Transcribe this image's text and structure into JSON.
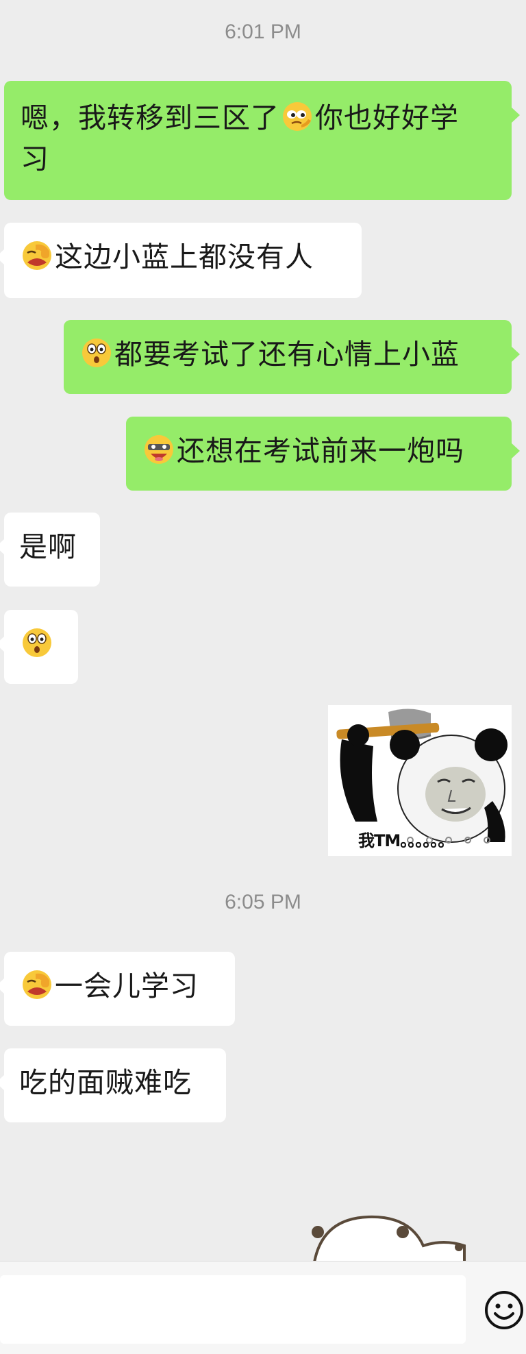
{
  "timestamps": [
    "6:01 PM",
    "6:05 PM"
  ],
  "messages": [
    {
      "side": "me",
      "parts": [
        {
          "text": "嗯，我转移到三区了"
        },
        {
          "icon": "smirk-emoji"
        },
        {
          "text": "你也好好学习"
        }
      ]
    },
    {
      "side": "them",
      "parts": [
        {
          "icon": "facepalm-emoji"
        },
        {
          "text": "这边小蓝上都没有人"
        }
      ]
    },
    {
      "side": "me",
      "parts": [
        {
          "icon": "shocked-emoji"
        },
        {
          "text": "都要考试了还有心情上小蓝"
        }
      ]
    },
    {
      "side": "me",
      "parts": [
        {
          "icon": "grin-emoji"
        },
        {
          "text": "还想在考试前来一炮吗"
        }
      ]
    },
    {
      "side": "them",
      "parts": [
        {
          "text": "是啊"
        }
      ]
    },
    {
      "side": "them",
      "parts": [
        {
          "icon": "shocked-emoji"
        }
      ]
    },
    {
      "side": "me",
      "parts": [
        {
          "sticker": "panda-axe-sticker",
          "caption": "我TM。。。。。。"
        }
      ]
    },
    {
      "side": "them",
      "parts": [
        {
          "icon": "facepalm-emoji"
        },
        {
          "text": "一会儿学习"
        }
      ]
    },
    {
      "side": "them",
      "parts": [
        {
          "text": "吃的面贼难吃"
        }
      ]
    }
  ],
  "m0": {
    "t1": "嗯，我转移到三区了",
    "t2": "你也好好学",
    "t3": "习"
  },
  "m1": {
    "t1": "这边小蓝上都没有人"
  },
  "m2": {
    "t1": "都要考试了还有心情上小蓝"
  },
  "m3": {
    "t1": "还想在考试前来一炮吗"
  },
  "m4": {
    "t1": "是啊"
  },
  "m6": {
    "caption": "我TM。。。。。。"
  },
  "m7": {
    "t1": "一会儿学习"
  },
  "m8": {
    "t1": "吃的面贼难吃"
  },
  "input": {
    "value": "",
    "emoji_button_icon": "smiley-face-icon"
  },
  "colors": {
    "background": "#ededed",
    "my_bubble": "#95ec69",
    "their_bubble": "#ffffff",
    "timestamp": "#8c8c8c"
  }
}
